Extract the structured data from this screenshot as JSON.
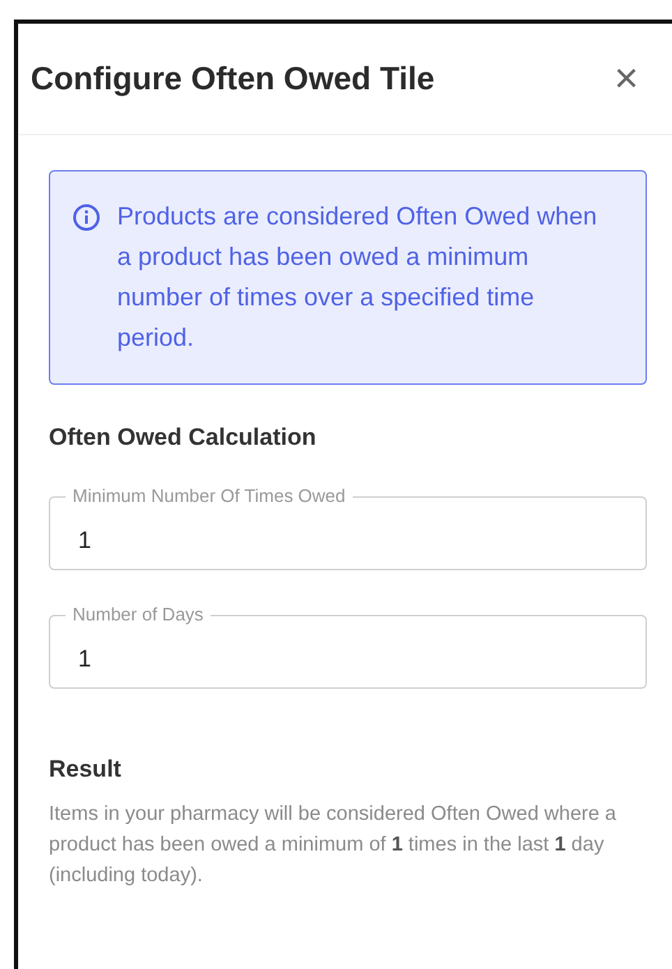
{
  "dialog": {
    "title": "Configure Often Owed Tile",
    "close": "×"
  },
  "info": "Products are considered Often Owed when a product has been owed a minimum number of times over a specified time period.",
  "section_title": "Often Owed Calculation",
  "fields": [
    {
      "label": "Minimum Number Of Times Owed",
      "value": "1"
    },
    {
      "label": "Number of Days",
      "value": "1"
    }
  ],
  "result": {
    "title": "Result",
    "text": "Items in your pharmacy will be considered Often Owed where a product has been owed a minimum of **1** times in the last **1** day (including today)."
  }
}
